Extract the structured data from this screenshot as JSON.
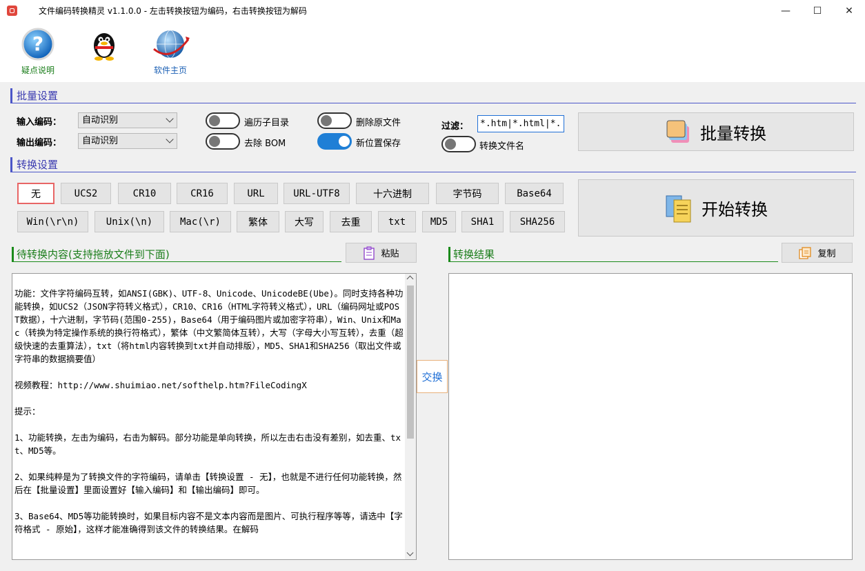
{
  "window": {
    "title": "文件编码转换精灵 v1.1.0.0 - 左击转换按钮为编码，右击转换按钮为解码",
    "minimize": "—",
    "maximize": "☐",
    "close": "✕"
  },
  "toolbar": {
    "help_label": "疑点说明",
    "home_label": "软件主页"
  },
  "batch": {
    "section_title": "批量设置",
    "input_label": "输入编码：",
    "input_value": "自动识别",
    "output_label": "输出编码：",
    "output_value": "自动识别",
    "toggle_subdirs": "遍历子目录",
    "toggle_bom": "去除 BOM",
    "toggle_delete": "删除原文件",
    "toggle_newloc": "新位置保存",
    "toggle_rename": "转换文件名",
    "filter_label": "过滤：",
    "filter_value": "*.htm|*.html|*.",
    "batch_button": "批量转换"
  },
  "convert": {
    "section_title": "转换设置",
    "buttons_row1": [
      "无",
      "UCS2",
      "CR10",
      "CR16",
      "URL",
      "URL-UTF8",
      "十六进制",
      "字节码",
      "Base64"
    ],
    "buttons_row2": [
      "Win(\\r\\n)",
      "Unix(\\n)",
      "Mac(\\r)",
      "繁体",
      "大写",
      "去重",
      "txt",
      "MD5",
      "SHA1",
      "SHA256"
    ],
    "start_button": "开始转换"
  },
  "source": {
    "title": "待转换内容(支持拖放文件到下面)",
    "paste_button": "粘贴",
    "content": "\n功能：文件字符编码互转，如ANSI(GBK)、UTF-8、Unicode、UnicodeBE(Ube)。同时支持各种功能转换，如UCS2（JSON字符转义格式），CR10、CR16（HTML字符转义格式），URL（编码网址或POST数据），十六进制，字节码(范围0-255)，Base64（用于编码图片或加密字符串），Win、Unix和Mac（转换为特定操作系统的换行符格式），繁体（中文繁简体互转），大写（字母大小写互转），去重（超级快速的去重算法），txt（将html内容转换到txt并自动排版），MD5、SHA1和SHA256（取出文件或字符串的数据摘要值）\n\n视频教程：http://www.shuimiao.net/softhelp.htm?FileCodingX\n\n提示：\n\n1、功能转换，左击为编码，右击为解码。部分功能是单向转换，所以左击右击没有差别，如去重、txt、MD5等。\n\n2、如果纯粹是为了转换文件的字符编码，请单击【转换设置 - 无】，也就是不进行任何功能转换，然后在【批量设置】里面设置好【输入编码】和【输出编码】即可。\n\n3、Base64、MD5等功能转换时，如果目标内容不是文本内容而是图片、可执行程序等等，请选中【字符格式 - 原始】，这样才能准确得到该文件的转换结果。在解码"
  },
  "swap_button": "交换",
  "result": {
    "title": "转换结果",
    "copy_button": "复制",
    "content": ""
  }
}
